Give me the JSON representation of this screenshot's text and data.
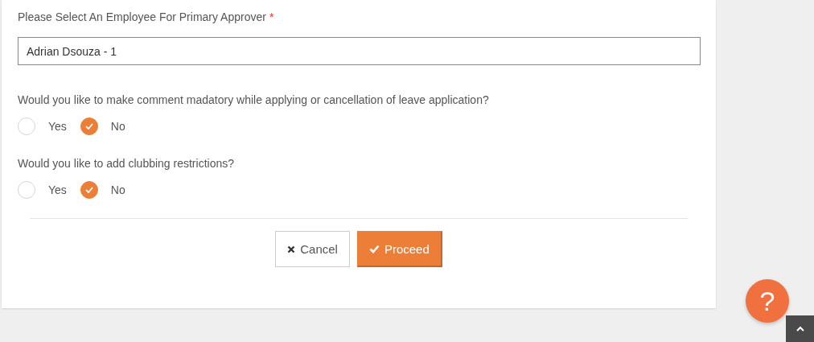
{
  "approver": {
    "label": "Please Select An Employee For Primary Approver",
    "required_mark": "*",
    "value": "Adrian Dsouza - 1"
  },
  "questions": [
    {
      "text": "Would you like to make comment madatory while applying or cancellation of leave application?",
      "options": [
        {
          "label": "Yes",
          "selected": false
        },
        {
          "label": "No",
          "selected": true
        }
      ]
    },
    {
      "text": "Would you like to add clubbing restrictions?",
      "options": [
        {
          "label": "Yes",
          "selected": false
        },
        {
          "label": "No",
          "selected": true
        }
      ]
    }
  ],
  "buttons": [
    {
      "kind": "cancel",
      "label": "Cancel"
    },
    {
      "kind": "proceed",
      "label": "Proceed"
    }
  ],
  "help": {
    "label": "?"
  }
}
